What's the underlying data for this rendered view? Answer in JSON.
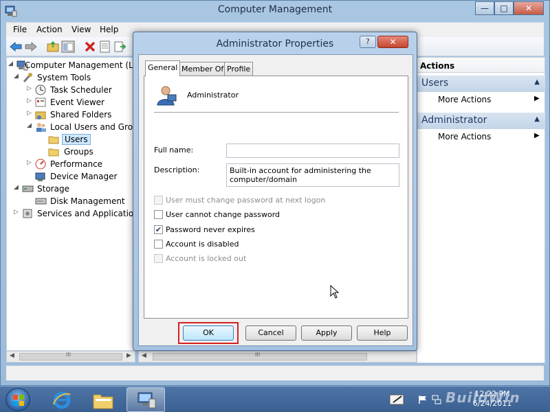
{
  "window": {
    "title": "Computer Management",
    "minimize": "—",
    "maximize": "□",
    "close": "✕"
  },
  "menu": [
    "File",
    "Action",
    "View",
    "Help"
  ],
  "tree": {
    "items": [
      {
        "label": "Computer Management (Local)",
        "arrow": "◢"
      },
      {
        "label": "System Tools",
        "arrow": "◢"
      },
      {
        "label": "Task Scheduler",
        "arrow": "▷"
      },
      {
        "label": "Event Viewer",
        "arrow": "▷"
      },
      {
        "label": "Shared Folders",
        "arrow": "▷"
      },
      {
        "label": "Local Users and Groups",
        "arrow": "◢"
      },
      {
        "label": "Users",
        "arrow": ""
      },
      {
        "label": "Groups",
        "arrow": ""
      },
      {
        "label": "Performance",
        "arrow": "▷"
      },
      {
        "label": "Device Manager",
        "arrow": ""
      },
      {
        "label": "Storage",
        "arrow": "◢"
      },
      {
        "label": "Disk Management",
        "arrow": ""
      },
      {
        "label": "Services and Applications",
        "arrow": "▷"
      }
    ],
    "scroll_grip": "III"
  },
  "center": {
    "scroll_grip": "III"
  },
  "actions": {
    "header": "Actions",
    "sections": [
      {
        "title": "Users",
        "item": "More Actions",
        "arrow": "▲",
        "more": "▶"
      },
      {
        "title": "Administrator",
        "item": "More Actions",
        "arrow": "▲",
        "more": "▶"
      }
    ]
  },
  "dialog": {
    "title": "Administrator Properties",
    "help": "?",
    "close": "✕",
    "tabs": [
      "General",
      "Member Of",
      "Profile"
    ],
    "active_tab": "General",
    "user_name": "Administrator",
    "full_name_label": "Full name:",
    "full_name_value": "",
    "description_label": "Description:",
    "description_value": "Built-in account for administering the computer/domain",
    "checkboxes": [
      {
        "label": "User must change password at next logon",
        "checked": false,
        "enabled": false
      },
      {
        "label": "User cannot change password",
        "checked": false,
        "enabled": true
      },
      {
        "label": "Password never expires",
        "checked": true,
        "enabled": true
      },
      {
        "label": "Account is disabled",
        "checked": false,
        "enabled": true
      },
      {
        "label": "Account is locked out",
        "checked": false,
        "enabled": false
      }
    ],
    "check_mark": "✔",
    "buttons": {
      "ok": "OK",
      "cancel": "Cancel",
      "apply": "Apply",
      "help": "Help"
    }
  },
  "taskbar": {
    "clock_time": "12:22 PM",
    "clock_date": "6/24/2011",
    "watermark": "BuildWin"
  },
  "colors": {
    "highlight": "#d32020",
    "selection": "#cce8ff",
    "accent": "#3a5f91"
  }
}
